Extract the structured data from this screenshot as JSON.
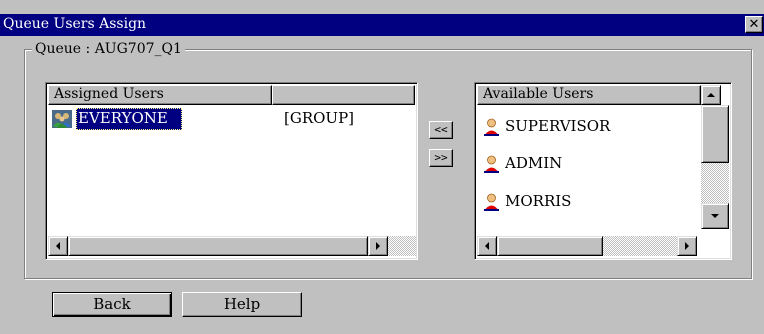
{
  "window": {
    "title": "Queue Users Assign",
    "close_glyph": "✕",
    "close_icon": "close-icon"
  },
  "group": {
    "label": "Queue : AUG707_Q1"
  },
  "assigned": {
    "header": "Assigned Users",
    "header2": "",
    "rows": [
      {
        "name": "EVERYONE",
        "type": "[GROUP]",
        "icon": "group-icon",
        "selected": true
      }
    ]
  },
  "move_buttons": {
    "add": "<<",
    "remove": ">>"
  },
  "available": {
    "header": "Available Users",
    "rows": [
      {
        "name": "SUPERVISOR",
        "icon": "user-icon"
      },
      {
        "name": "ADMIN",
        "icon": "user-icon"
      },
      {
        "name": "MORRIS",
        "icon": "user-icon"
      }
    ]
  },
  "buttons": {
    "back": "Back",
    "help": "Help"
  },
  "colors": {
    "titlebar": "#000080",
    "face": "#c0c0c0",
    "selection": "#000080",
    "user_icon": "#e00000"
  }
}
